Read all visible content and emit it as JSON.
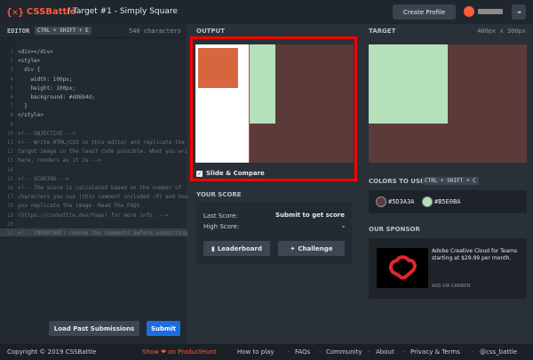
{
  "header": {
    "logo_glyph": "{✕}",
    "logo_text": "CSSBattle",
    "page_title": "/ Target #1 - Simply Square",
    "create_profile": "Create Profile",
    "logout_icon": "⇥"
  },
  "editor": {
    "label": "EDITOR",
    "shortcut": "CTRL + SHIFT + E",
    "char_count": "540 characters",
    "line_numbers": [
      "1",
      "2",
      "3",
      "4",
      "5",
      "6",
      "7",
      "8",
      "9",
      "10",
      "11",
      "12",
      "13",
      "14",
      "15",
      "16",
      "17",
      "18",
      "19",
      "20",
      "21"
    ],
    "lines": [
      "<div></div>",
      "<style>",
      "  div {",
      "    width: 100px;",
      "    height: 100px;",
      "    background: #dd6b4d;",
      "  }",
      "</style>",
      "",
      "<!-- OBJECTIVE -->",
      "<!-- Write HTML/CSS in this editor and replicate the given",
      "target image in the least code possible. What you write",
      "here, renders as it is -->",
      "",
      "<!-- SCORING -->",
      "<!-- The score is calculated based on the number of",
      "characters you use (this comment included :P) and how close",
      "you replicate the image. Read the FAQS",
      "(https://cssbattle.dev/faqs) for more info. -->",
      "",
      "<!-- IMPORTANT: remove the comments before submitting -->"
    ],
    "load_past": "Load Past Submissions",
    "submit": "Submit"
  },
  "output": {
    "label": "OUTPUT",
    "slide_compare": "Slide & Compare"
  },
  "score": {
    "label": "YOUR SCORE",
    "last_key": "Last Score:",
    "last_val": "Submit to get score",
    "high_key": "High Score:",
    "high_val": "-",
    "leaderboard": "Leaderboard",
    "challenge": "Challenge"
  },
  "target": {
    "label": "TARGET",
    "size": "400px x 300px",
    "colors_label": "COLORS TO USE",
    "colors_shortcut": "CTRL + SHIFT + C",
    "colors": [
      {
        "hex": "#5D3A3A",
        "label": "#5D3A3A"
      },
      {
        "hex": "#B5E0BA",
        "label": "#B5E0BA"
      }
    ],
    "sponsor_label": "OUR SPONSOR",
    "ad_text": "Adobe Creative Cloud for Teams starting at $29.99 per month.",
    "ad_via": "ADS VIA CARBON"
  },
  "footer": {
    "copyright": "Copyright © 2019 CSSBattle",
    "show_on": "Show ❤ on ProductHunt",
    "links": [
      "How to play",
      "FAQs",
      "Community",
      "About",
      "Privacy & Terms",
      "@css_battle"
    ]
  }
}
